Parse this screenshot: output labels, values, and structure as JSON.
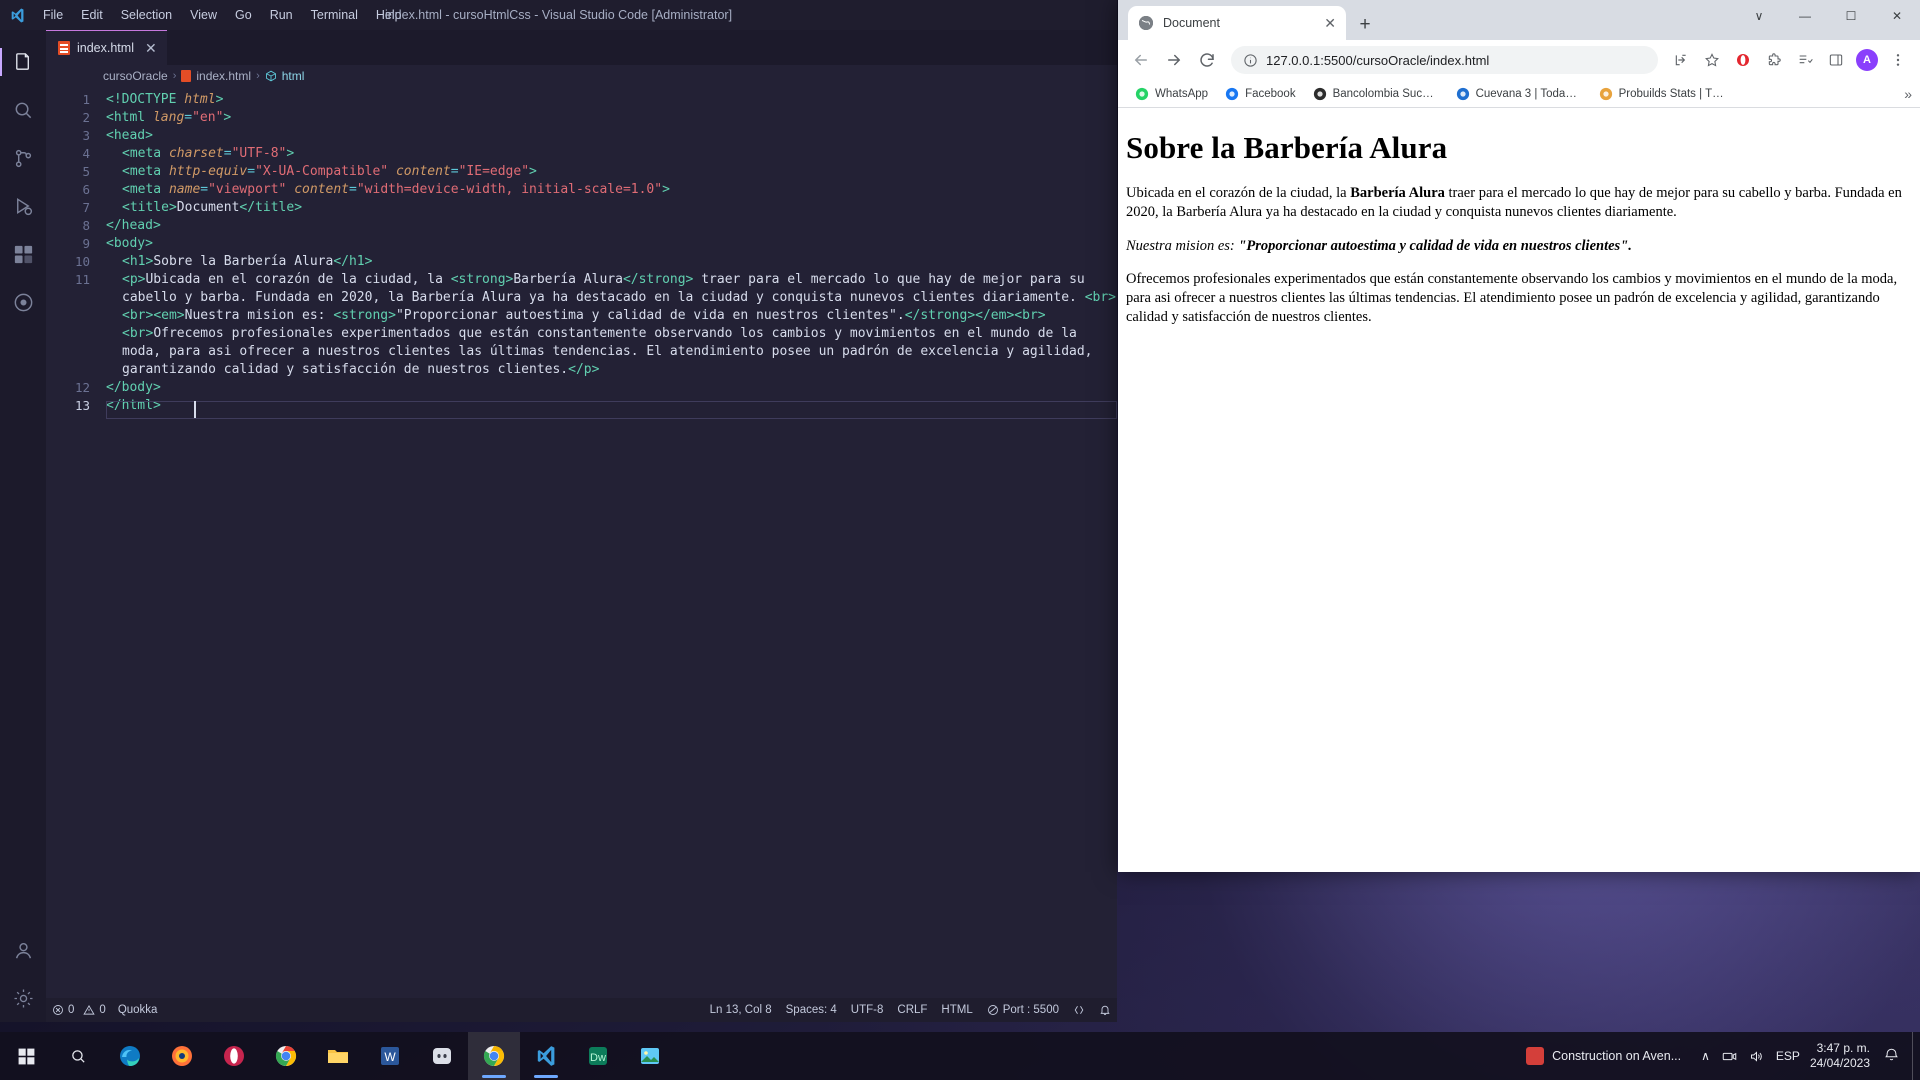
{
  "vscode": {
    "window_title": "index.html - cursoHtmlCss - Visual Studio Code [Administrator]",
    "menu": [
      "File",
      "Edit",
      "Selection",
      "View",
      "Go",
      "Run",
      "Terminal",
      "Help"
    ],
    "tab": {
      "label": "index.html",
      "close": "✕",
      "icon": "html5-file-icon"
    },
    "breadcrumb": {
      "folder": "cursoOracle",
      "file": "index.html",
      "symbol": "html",
      "separator": "›"
    },
    "activity_icons": [
      "explorer-icon",
      "search-icon",
      "source-control-icon",
      "run-debug-icon",
      "extensions-icon",
      "live-preview-icon",
      "account-icon",
      "settings-gear-icon"
    ],
    "code": [
      {
        "n": "1",
        "tokens": [
          {
            "t": "tag",
            "v": "<!DOCTYPE "
          },
          {
            "t": "attr",
            "v": "html"
          },
          {
            "t": "tag",
            "v": ">"
          }
        ],
        "indent": 0
      },
      {
        "n": "2",
        "tokens": [
          {
            "t": "tag",
            "v": "<html "
          },
          {
            "t": "attr",
            "v": "lang"
          },
          {
            "t": "punc",
            "v": "="
          },
          {
            "t": "str",
            "v": "\"en\""
          },
          {
            "t": "tag",
            "v": ">"
          }
        ],
        "indent": 0
      },
      {
        "n": "3",
        "tokens": [
          {
            "t": "tag",
            "v": "<head>"
          }
        ],
        "indent": 0
      },
      {
        "n": "4",
        "tokens": [
          {
            "t": "tag",
            "v": "<meta "
          },
          {
            "t": "attr",
            "v": "charset"
          },
          {
            "t": "punc",
            "v": "="
          },
          {
            "t": "str",
            "v": "\"UTF-8\""
          },
          {
            "t": "tag",
            "v": ">"
          }
        ],
        "indent": 1
      },
      {
        "n": "5",
        "tokens": [
          {
            "t": "tag",
            "v": "<meta "
          },
          {
            "t": "attr",
            "v": "http-equiv"
          },
          {
            "t": "punc",
            "v": "="
          },
          {
            "t": "str",
            "v": "\"X-UA-Compatible\""
          },
          {
            "t": "txt",
            "v": " "
          },
          {
            "t": "attr",
            "v": "content"
          },
          {
            "t": "punc",
            "v": "="
          },
          {
            "t": "str",
            "v": "\"IE=edge\""
          },
          {
            "t": "tag",
            "v": ">"
          }
        ],
        "indent": 1
      },
      {
        "n": "6",
        "tokens": [
          {
            "t": "tag",
            "v": "<meta "
          },
          {
            "t": "attr",
            "v": "name"
          },
          {
            "t": "punc",
            "v": "="
          },
          {
            "t": "str",
            "v": "\"viewport\""
          },
          {
            "t": "txt",
            "v": " "
          },
          {
            "t": "attr",
            "v": "content"
          },
          {
            "t": "punc",
            "v": "="
          },
          {
            "t": "str",
            "v": "\"width=device-width, initial-scale=1.0\""
          },
          {
            "t": "tag",
            "v": ">"
          }
        ],
        "indent": 1
      },
      {
        "n": "7",
        "tokens": [
          {
            "t": "tag",
            "v": "<title>"
          },
          {
            "t": "txt",
            "v": "Document"
          },
          {
            "t": "tag",
            "v": "</title>"
          }
        ],
        "indent": 1
      },
      {
        "n": "8",
        "tokens": [
          {
            "t": "tag",
            "v": "</head>"
          }
        ],
        "indent": 0
      },
      {
        "n": "9",
        "tokens": [
          {
            "t": "tag",
            "v": "<body>"
          }
        ],
        "indent": 0
      },
      {
        "n": "10",
        "tokens": [
          {
            "t": "tag",
            "v": "<h1>"
          },
          {
            "t": "txt",
            "v": "Sobre la Barbería Alura"
          },
          {
            "t": "tag",
            "v": "</h1>"
          }
        ],
        "indent": 1
      },
      {
        "n": "11",
        "tokens": [
          {
            "t": "tag",
            "v": "<p>"
          },
          {
            "t": "txt",
            "v": "Ubicada en el corazón de la ciudad, la "
          },
          {
            "t": "tag",
            "v": "<strong>"
          },
          {
            "t": "txt",
            "v": "Barbería Alura"
          },
          {
            "t": "tag",
            "v": "</strong>"
          },
          {
            "t": "txt",
            "v": " traer para el mercado lo que hay de mejor para su cabello y barba. Fundada en 2020, la Barbería Alura ya ha destacado en la ciudad y conquista nunevos clientes diariamente. "
          },
          {
            "t": "tag",
            "v": "<br>"
          },
          {
            "t": "tag",
            "v": "<br>"
          },
          {
            "t": "tag",
            "v": "<em>"
          },
          {
            "t": "txt",
            "v": "Nuestra mision es: "
          },
          {
            "t": "tag",
            "v": "<strong>"
          },
          {
            "t": "txt",
            "v": "\"Proporcionar autoestima y calidad de vida en nuestros clientes\"."
          },
          {
            "t": "tag",
            "v": "</strong>"
          },
          {
            "t": "tag",
            "v": "</em>"
          },
          {
            "t": "tag",
            "v": "<br>"
          },
          {
            "t": "tag",
            "v": "<br>"
          },
          {
            "t": "txt",
            "v": "Ofrecemos profesionales experimentados que están constantemente observando los cambios y movimientos en el mundo de la moda, para asi ofrecer a nuestros clientes las últimas tendencias. El atendimiento posee un padrón de excelencia y agilidad, garantizando calidad y satisfacción de nuestros clientes."
          },
          {
            "t": "tag",
            "v": "</p>"
          }
        ],
        "indent": 1
      },
      {
        "n": "12",
        "tokens": [
          {
            "t": "tag",
            "v": "</body>"
          }
        ],
        "indent": 0
      },
      {
        "n": "13",
        "tokens": [
          {
            "t": "tag",
            "v": "</html>"
          }
        ],
        "indent": 0
      }
    ],
    "statusbar": {
      "errors": "0",
      "warnings": "0",
      "quokka": "Quokka",
      "position": "Ln 13, Col 8",
      "spaces": "Spaces: 4",
      "encoding": "UTF-8",
      "eol": "CRLF",
      "language": "HTML",
      "port": "Port : 5500",
      "remote_icon": "remote-window-icon",
      "bell_icon": "notifications-bell-icon"
    }
  },
  "browser": {
    "tab": {
      "title": "Document",
      "favicon": "globe-favicon",
      "close": "✕"
    },
    "new_tab_label": "+",
    "window_controls": {
      "minimize": "—",
      "maximize": "☐",
      "close": "✕",
      "more": "∨"
    },
    "toolbar": {
      "back": "←",
      "forward": "→",
      "reload": "↻",
      "url": "127.0.0.1:5500/cursoOracle/index.html",
      "info_icon": "site-info-icon",
      "share_icon": "share-icon",
      "bookmark_star_icon": "star-icon",
      "opera_ext_icon": "opera-extension-icon",
      "extensions_icon": "puzzle-extensions-icon",
      "reading_list_icon": "reading-list-icon",
      "sidepanel_icon": "side-panel-icon",
      "avatar_letter": "A",
      "menu_icon": "three-dot-menu-icon"
    },
    "bookmarks": [
      {
        "label": "WhatsApp",
        "icon": "whatsapp-icon",
        "color": "#25d366"
      },
      {
        "label": "Facebook",
        "icon": "facebook-icon",
        "color": "#1877f2"
      },
      {
        "label": "Bancolombia Sucur...",
        "icon": "bancolombia-icon",
        "color": "#2c2c2c"
      },
      {
        "label": "Cuevana 3 | Todas l...",
        "icon": "cuevana-icon",
        "color": "#1f6fd0"
      },
      {
        "label": "Probuilds Stats | Th...",
        "icon": "probuilds-icon",
        "color": "#e8a33d"
      }
    ],
    "bookmarks_overflow": "»",
    "page": {
      "h1": "Sobre la Barbería Alura",
      "p1_a": "Ubicada en el corazón de la ciudad, la ",
      "p1_strong": "Barbería Alura",
      "p1_b": " traer para el mercado lo que hay de mejor para su cabello y barba. Fundada en 2020, la Barbería Alura ya ha destacado en la ciudad y conquista nunevos clientes diariamente.",
      "p2_em": "Nuestra mision es: ",
      "p2_em_strong": "\"Proporcionar autoestima y calidad de vida en nuestros clientes\".",
      "p3": "Ofrecemos profesionales experimentados que están constantemente observando los cambios y movimientos en el mundo de la moda, para asi ofrecer a nuestros clientes las últimas tendencias. El atendimiento posee un padrón de excelencia y agilidad, garantizando calidad y satisfacción de nuestros clientes."
    }
  },
  "taskbar": {
    "start_icon": "windows-start-icon",
    "search_icon": "search-icon",
    "apps": [
      {
        "name": "edge-icon"
      },
      {
        "name": "chrome-icon"
      },
      {
        "name": "firefox-icon"
      },
      {
        "name": "opera-icon"
      },
      {
        "name": "chrome-canary-icon"
      },
      {
        "name": "file-explorer-icon"
      },
      {
        "name": "word-icon"
      },
      {
        "name": "discord-icon"
      },
      {
        "name": "opera-gx-icon"
      },
      {
        "name": "vscode-icon"
      },
      {
        "name": "dreamweaver-icon"
      },
      {
        "name": "photos-icon"
      }
    ],
    "news": {
      "label": "Construction on Aven...",
      "icon": "news-weather-icon"
    },
    "tray": {
      "chevron": "∧",
      "network_icon": "network-icon",
      "volume_icon": "volume-icon",
      "language": "ESP",
      "notifications_icon": "notification-center-icon"
    },
    "clock": {
      "time": "3:47 p. m.",
      "date": "24/04/2023"
    }
  }
}
